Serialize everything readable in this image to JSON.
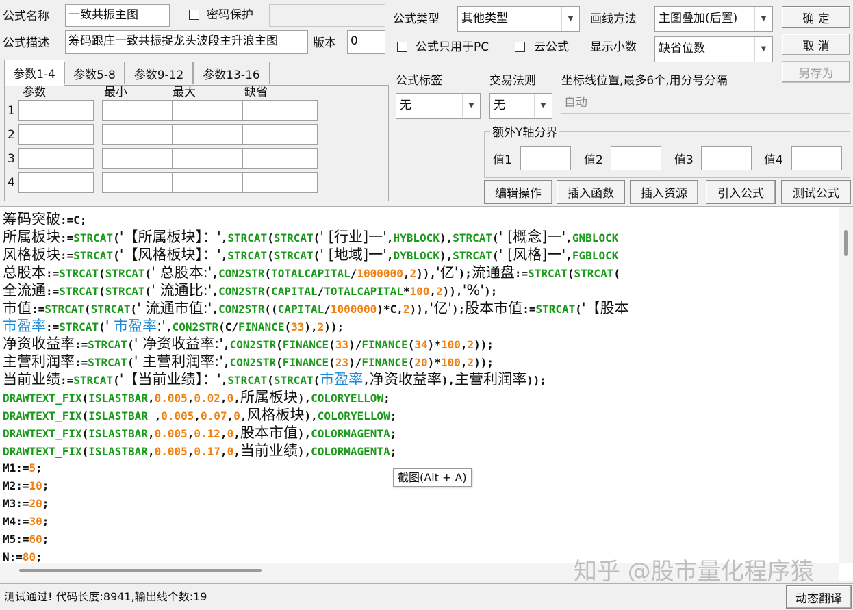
{
  "top": {
    "name_label": "公式名称",
    "name_value": "一致共振主图",
    "password_label": "密码保护",
    "desc_label": "公式描述",
    "desc_value": "筹码跟庄一致共振捉龙头波段主升浪主图",
    "version_label": "版本",
    "version_value": "0",
    "type_label": "公式类型",
    "type_value": "其他类型",
    "draw_label": "画线方法",
    "draw_value": "主图叠加(后置)",
    "pc_only_label": "公式只用于PC",
    "cloud_label": "云公式",
    "decimal_label": "显示小数",
    "decimal_value": "缺省位数"
  },
  "buttons": {
    "ok": "确 定",
    "cancel": "取 消",
    "save_as": "另存为",
    "edit": "编辑操作",
    "insert_func": "插入函数",
    "insert_res": "插入资源",
    "import": "引入公式",
    "test": "测试公式",
    "translate": "动态翻译"
  },
  "params": {
    "tabs": [
      "参数1-4",
      "参数5-8",
      "参数9-12",
      "参数13-16"
    ],
    "headers": [
      "参数",
      "最小",
      "最大",
      "缺省"
    ],
    "rows": [
      "1",
      "2",
      "3",
      "4"
    ]
  },
  "options": {
    "tag_label": "公式标签",
    "tag_value": "无",
    "rule_label": "交易法则",
    "rule_value": "无",
    "coord_label": "坐标线位置,最多6个,用分号分隔",
    "coord_value": "自动",
    "yaxis_label": "额外Y轴分界",
    "val_labels": [
      "值1",
      "值2",
      "值3",
      "值4"
    ]
  },
  "tooltip": "截图(Alt + A)",
  "watermark": "知乎 @股市量化程序猿",
  "status": "测试通过! 代码长度:8941,输出线个数:19",
  "colors": {
    "function": "#1a9a1a",
    "number": "#f08010",
    "highlight": "#1a8ad8"
  }
}
